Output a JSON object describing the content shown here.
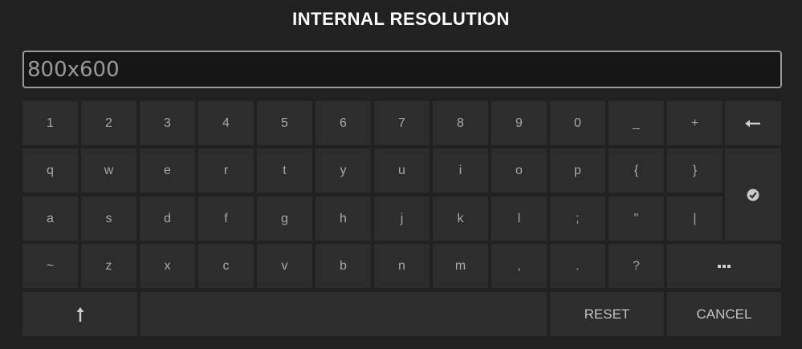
{
  "dialog": {
    "title": "INTERNAL RESOLUTION",
    "input_value": "800x600"
  },
  "keyboard": {
    "row1": [
      "1",
      "2",
      "3",
      "4",
      "5",
      "6",
      "7",
      "8",
      "9",
      "0",
      "_",
      "+"
    ],
    "row2": [
      "q",
      "w",
      "e",
      "r",
      "t",
      "y",
      "u",
      "i",
      "o",
      "p",
      "{",
      "}"
    ],
    "row3": [
      "a",
      "s",
      "d",
      "f",
      "g",
      "h",
      "j",
      "k",
      "l",
      ";",
      "\"",
      "|"
    ],
    "row4": [
      "~",
      "z",
      "x",
      "c",
      "v",
      "b",
      "n",
      "m",
      ",",
      ".",
      "?"
    ],
    "backspace_icon": "backspace-arrow-icon",
    "enter_icon": "check-circle-icon",
    "symbols_icon": "ellipsis-icon",
    "shift_icon": "shift-arrow-icon",
    "reset_label": "RESET",
    "cancel_label": "CANCEL"
  }
}
